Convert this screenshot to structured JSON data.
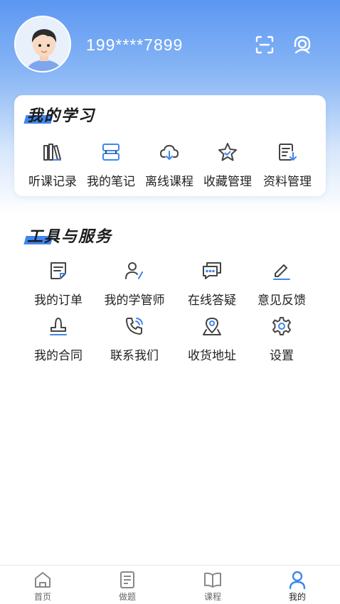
{
  "profile": {
    "phone": "199****7899",
    "icons": [
      "avatar",
      "scan-icon",
      "customer-service-icon"
    ]
  },
  "my_study": {
    "title": "我的学习",
    "items": [
      {
        "label": "听课记录",
        "icon": "books-icon"
      },
      {
        "label": "我的笔记",
        "icon": "notes-icon"
      },
      {
        "label": "离线课程",
        "icon": "cloud-download-icon"
      },
      {
        "label": "收藏管理",
        "icon": "star-icon"
      },
      {
        "label": "资料管理",
        "icon": "document-download-icon"
      }
    ]
  },
  "tools": {
    "title": "工具与服务",
    "items": [
      {
        "label": "我的订单",
        "icon": "order-icon"
      },
      {
        "label": "我的学管师",
        "icon": "tutor-icon"
      },
      {
        "label": "在线答疑",
        "icon": "chat-icon"
      },
      {
        "label": "意见反馈",
        "icon": "edit-icon"
      },
      {
        "label": "我的合同",
        "icon": "stamp-icon"
      },
      {
        "label": "联系我们",
        "icon": "phone-icon"
      },
      {
        "label": "收货地址",
        "icon": "location-icon"
      },
      {
        "label": "设置",
        "icon": "gear-icon"
      }
    ]
  },
  "tabbar": {
    "tabs": [
      {
        "label": "首页",
        "icon": "home-icon"
      },
      {
        "label": "做题",
        "icon": "exercise-icon"
      },
      {
        "label": "课程",
        "icon": "course-book-icon"
      },
      {
        "label": "我的",
        "icon": "user-icon",
        "active": true
      }
    ]
  },
  "colors": {
    "accent": "#3f86ee",
    "header_top": "#5b97f2",
    "icon_gray": "#444444"
  }
}
